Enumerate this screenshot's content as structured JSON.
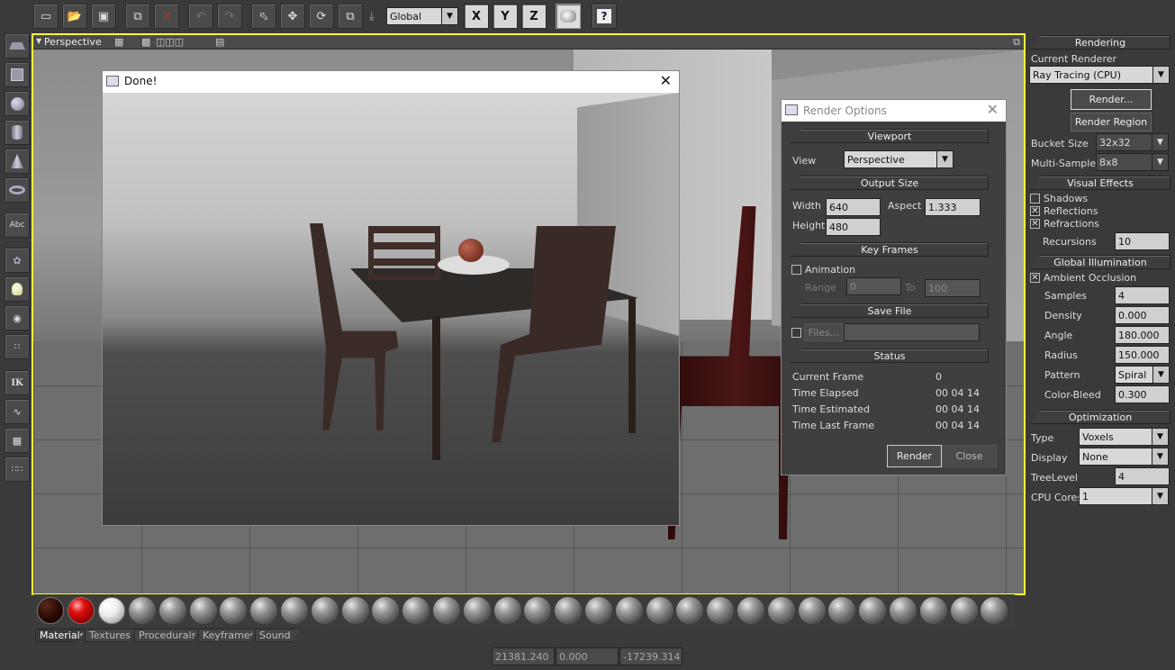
{
  "toolbar": {
    "coord_system": "Global",
    "axis_x": "X",
    "axis_y": "Y",
    "axis_z": "Z",
    "help": "?"
  },
  "viewport": {
    "name": "Perspective"
  },
  "left_toolbar": {
    "text_tool": "Abc",
    "ik_tool": "IK"
  },
  "render_window": {
    "title": "Done!"
  },
  "render_options": {
    "title": "Render Options",
    "viewport_header": "Viewport",
    "view_label": "View",
    "view_value": "Perspective",
    "output_header": "Output Size",
    "width_label": "Width",
    "width_value": "640",
    "height_label": "Height",
    "height_value": "480",
    "aspect_label": "Aspect",
    "aspect_value": "1.333",
    "keyframes_header": "Key Frames",
    "animation_label": "Animation",
    "range_label": "Range",
    "range_from": "0",
    "range_to_label": "To",
    "range_to": "100",
    "save_header": "Save File",
    "files_button": "Files...",
    "status_header": "Status",
    "status": [
      {
        "label": "Current Frame",
        "value": "0"
      },
      {
        "label": "Time Elapsed",
        "value": "00 04 14"
      },
      {
        "label": "Time Estimated",
        "value": "00 04 14"
      },
      {
        "label": "Time Last Frame",
        "value": "00 04 14"
      }
    ],
    "render_button": "Render",
    "close_button": "Close"
  },
  "right_panel": {
    "rendering_header": "Rendering",
    "current_renderer_label": "Current Renderer",
    "renderer_value": "Ray Tracing (CPU)",
    "render_button": "Render...",
    "render_region_button": "Render Region",
    "bucket_size_label": "Bucket Size",
    "bucket_size_value": "32x32",
    "multisamples_label": "Multi-Samples",
    "multisamples_value": "8x8",
    "visual_effects_header": "Visual Effects",
    "shadows_label": "Shadows",
    "reflections_label": "Reflections",
    "refractions_label": "Refractions",
    "recursions_label": "Recursions",
    "recursions_value": "10",
    "gi_header": "Global Illumination",
    "ao_label": "Ambient Occlusion",
    "samples_label": "Samples",
    "samples_value": "4",
    "density_label": "Density",
    "density_value": "0.000",
    "angle_label": "Angle",
    "angle_value": "180.000",
    "radius_label": "Radius",
    "radius_value": "150.000",
    "pattern_label": "Pattern",
    "pattern_value": "Spiral",
    "color_bleed_label": "Color-Bleed",
    "color_bleed_value": "0.300",
    "optimization_header": "Optimization",
    "type_label": "Type",
    "type_value": "Voxels",
    "display_label": "Display",
    "display_value": "None",
    "treelevel_label": "TreeLevel",
    "treelevel_value": "4",
    "cpu_cores_label": "CPU Cores",
    "cpu_cores_value": "1"
  },
  "material_tabs": [
    "Materials",
    "Textures",
    "Procedurals",
    "Keyframes",
    "Sound"
  ],
  "coordinates": {
    "x": "21381.240",
    "y": "0.000",
    "z": "-17239.314"
  }
}
